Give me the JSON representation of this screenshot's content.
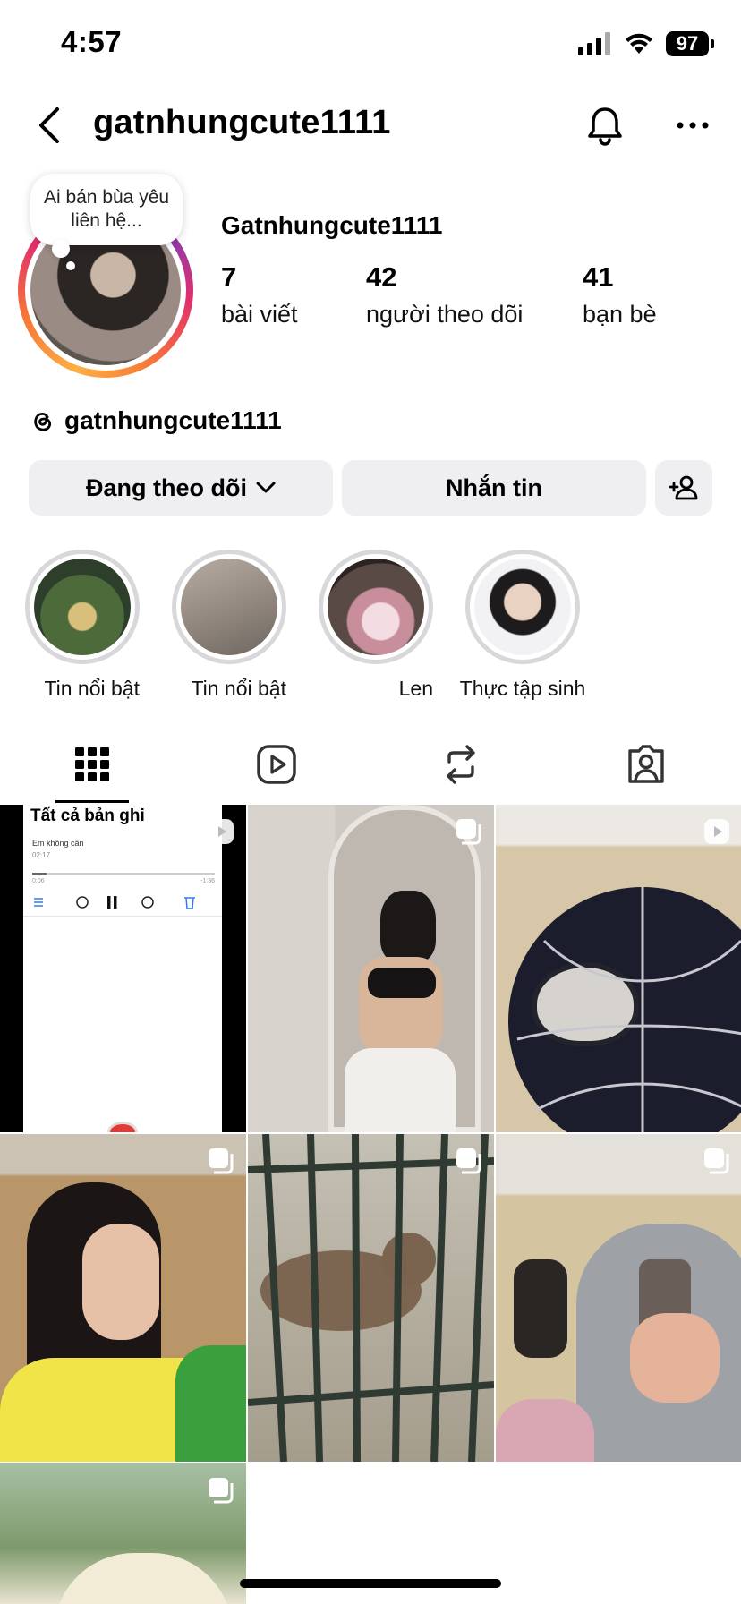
{
  "status_bar": {
    "time": "4:57",
    "battery": "97"
  },
  "header": {
    "username": "gatnhungcute1111"
  },
  "profile": {
    "note": "Ai bán bùa yêu liên hệ...",
    "display_name": "Gatnhungcute1111",
    "stats": [
      {
        "value": "7",
        "label": "bài viết"
      },
      {
        "value": "42",
        "label": "người theo dõi"
      },
      {
        "value": "41",
        "label": "bạn bè"
      }
    ],
    "threads_handle": "gatnhungcute1111"
  },
  "actions": {
    "following_label": "Đang theo dõi",
    "message_label": "Nhắn tin"
  },
  "highlights": [
    {
      "label": "Tin nổi bật"
    },
    {
      "label": "Tin nổi bật"
    },
    {
      "label": "Len"
    },
    {
      "label": "Thực tập sinh"
    }
  ],
  "posts": {
    "first_post": {
      "title": "Tất cả bản ghi",
      "recording_name": "Em không cần",
      "recording_time": "02:17",
      "elapsed": "0:06",
      "remaining": "-1:36"
    }
  },
  "colors": {
    "button_bg": "#efeff2",
    "highlight_ring": "#d8d8da"
  }
}
